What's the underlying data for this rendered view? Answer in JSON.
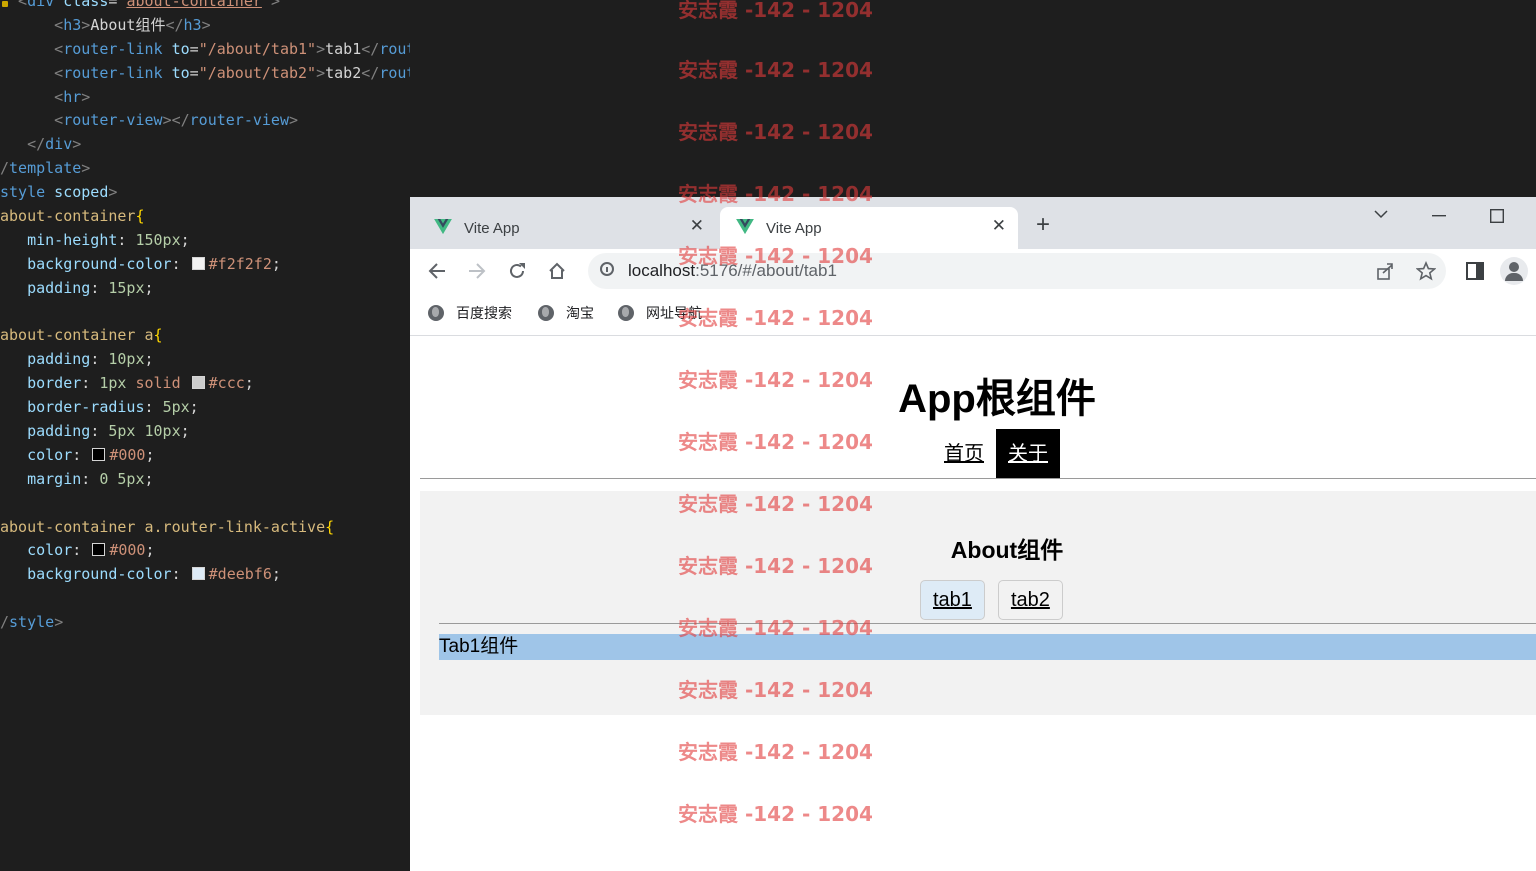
{
  "editor": {
    "lines": [
      {
        "parts": [
          {
            "c": "t-ang",
            "t": "  <"
          },
          {
            "c": "t-tag",
            "t": "div"
          },
          {
            "c": "t-attr",
            "t": " class"
          },
          {
            "c": "t-punc",
            "t": "="
          },
          {
            "c": "t-str",
            "t": "\""
          },
          {
            "c": "t-str t-ul",
            "t": "about-container"
          },
          {
            "c": "t-str",
            "t": "\""
          },
          {
            "c": "t-ang",
            "t": ">"
          }
        ]
      },
      {
        "parts": [
          {
            "c": "t-ang",
            "t": "      <"
          },
          {
            "c": "t-tag",
            "t": "h3"
          },
          {
            "c": "t-ang",
            "t": ">"
          },
          {
            "c": "t-txt",
            "t": "About组件"
          },
          {
            "c": "t-ang",
            "t": "</"
          },
          {
            "c": "t-tag",
            "t": "h3"
          },
          {
            "c": "t-ang",
            "t": ">"
          }
        ]
      },
      {
        "parts": [
          {
            "c": "t-ang",
            "t": "      <"
          },
          {
            "c": "t-tag",
            "t": "router-link"
          },
          {
            "c": "t-attr",
            "t": " to"
          },
          {
            "c": "t-punc",
            "t": "="
          },
          {
            "c": "t-str",
            "t": "\"/about/tab1\""
          },
          {
            "c": "t-ang",
            "t": ">"
          },
          {
            "c": "t-txt",
            "t": "tab1"
          },
          {
            "c": "t-ang",
            "t": "</"
          },
          {
            "c": "t-tag",
            "t": "router-link"
          },
          {
            "c": "t-ang",
            "t": ">"
          }
        ]
      },
      {
        "parts": [
          {
            "c": "t-ang",
            "t": "      <"
          },
          {
            "c": "t-tag",
            "t": "router-link"
          },
          {
            "c": "t-attr",
            "t": " to"
          },
          {
            "c": "t-punc",
            "t": "="
          },
          {
            "c": "t-str",
            "t": "\"/about/tab2\""
          },
          {
            "c": "t-ang",
            "t": ">"
          },
          {
            "c": "t-txt",
            "t": "tab2"
          },
          {
            "c": "t-ang",
            "t": "</"
          },
          {
            "c": "t-tag",
            "t": "router-link"
          },
          {
            "c": "t-ang",
            "t": ">"
          }
        ]
      },
      {
        "parts": [
          {
            "c": "t-ang",
            "t": "      <"
          },
          {
            "c": "t-tag",
            "t": "hr"
          },
          {
            "c": "t-ang",
            "t": ">"
          }
        ]
      },
      {
        "parts": [
          {
            "c": "t-ang",
            "t": "      <"
          },
          {
            "c": "t-tag",
            "t": "router-view"
          },
          {
            "c": "t-ang",
            "t": "></"
          },
          {
            "c": "t-tag",
            "t": "router-view"
          },
          {
            "c": "t-ang",
            "t": ">"
          }
        ]
      },
      {
        "parts": [
          {
            "c": "t-ang",
            "t": "   </"
          },
          {
            "c": "t-tag",
            "t": "div"
          },
          {
            "c": "t-ang",
            "t": ">"
          }
        ]
      },
      {
        "parts": [
          {
            "c": "t-ang",
            "t": "/"
          },
          {
            "c": "t-tag",
            "t": "template"
          },
          {
            "c": "t-ang",
            "t": ">"
          }
        ]
      },
      {
        "parts": [
          {
            "c": "t-tag",
            "t": "style"
          },
          {
            "c": "t-attr",
            "t": " scoped"
          },
          {
            "c": "t-ang",
            "t": ">"
          }
        ]
      },
      {
        "parts": [
          {
            "c": "t-sel",
            "t": "about-container"
          },
          {
            "c": "t-brace",
            "t": "{"
          }
        ]
      },
      {
        "parts": [
          {
            "c": "t-prop",
            "t": "   min-height"
          },
          {
            "c": "t-punc",
            "t": ": "
          },
          {
            "c": "t-num",
            "t": "150px"
          },
          {
            "c": "t-punc",
            "t": ";"
          }
        ]
      },
      {
        "parts": [
          {
            "c": "t-prop",
            "t": "   background-color"
          },
          {
            "c": "t-punc",
            "t": ": "
          },
          {
            "sw": "#f2f2f2"
          },
          {
            "c": "t-val",
            "t": "#f2f2f2"
          },
          {
            "c": "t-punc",
            "t": ";"
          }
        ]
      },
      {
        "parts": [
          {
            "c": "t-prop",
            "t": "   padding"
          },
          {
            "c": "t-punc",
            "t": ": "
          },
          {
            "c": "t-num",
            "t": "15px"
          },
          {
            "c": "t-punc",
            "t": ";"
          }
        ]
      },
      {
        "parts": []
      },
      {
        "parts": [
          {
            "c": "t-sel",
            "t": "about-container a"
          },
          {
            "c": "t-brace",
            "t": "{"
          }
        ]
      },
      {
        "parts": [
          {
            "c": "t-prop",
            "t": "   padding"
          },
          {
            "c": "t-punc",
            "t": ": "
          },
          {
            "c": "t-num",
            "t": "10px"
          },
          {
            "c": "t-punc",
            "t": ";"
          }
        ]
      },
      {
        "parts": [
          {
            "c": "t-prop",
            "t": "   border"
          },
          {
            "c": "t-punc",
            "t": ": "
          },
          {
            "c": "t-num",
            "t": "1px"
          },
          {
            "c": "t-val",
            "t": " solid "
          },
          {
            "sw": "#cccccc"
          },
          {
            "c": "t-val",
            "t": "#ccc"
          },
          {
            "c": "t-punc",
            "t": ";"
          }
        ]
      },
      {
        "parts": [
          {
            "c": "t-prop",
            "t": "   border-radius"
          },
          {
            "c": "t-punc",
            "t": ": "
          },
          {
            "c": "t-num",
            "t": "5px"
          },
          {
            "c": "t-punc",
            "t": ";"
          }
        ]
      },
      {
        "parts": [
          {
            "c": "t-prop",
            "t": "   padding"
          },
          {
            "c": "t-punc",
            "t": ": "
          },
          {
            "c": "t-num",
            "t": "5px 10px"
          },
          {
            "c": "t-punc",
            "t": ";"
          }
        ]
      },
      {
        "parts": [
          {
            "c": "t-prop",
            "t": "   color"
          },
          {
            "c": "t-punc",
            "t": ": "
          },
          {
            "sw": "#000000"
          },
          {
            "c": "t-val",
            "t": "#000"
          },
          {
            "c": "t-punc",
            "t": ";"
          }
        ]
      },
      {
        "parts": [
          {
            "c": "t-prop",
            "t": "   margin"
          },
          {
            "c": "t-punc",
            "t": ": "
          },
          {
            "c": "t-num",
            "t": "0 5px"
          },
          {
            "c": "t-punc",
            "t": ";"
          }
        ]
      },
      {
        "parts": []
      },
      {
        "parts": [
          {
            "c": "t-sel",
            "t": "about-container a.router-link-active"
          },
          {
            "c": "t-brace",
            "t": "{"
          }
        ]
      },
      {
        "parts": [
          {
            "c": "t-prop",
            "t": "   color"
          },
          {
            "c": "t-punc",
            "t": ": "
          },
          {
            "sw": "#000000"
          },
          {
            "c": "t-val",
            "t": "#000"
          },
          {
            "c": "t-punc",
            "t": ";"
          }
        ]
      },
      {
        "parts": [
          {
            "c": "t-prop",
            "t": "   background-color"
          },
          {
            "c": "t-punc",
            "t": ": "
          },
          {
            "sw": "#deebf6"
          },
          {
            "c": "t-val",
            "t": "#deebf6"
          },
          {
            "c": "t-punc",
            "t": ";"
          }
        ]
      },
      {
        "parts": []
      },
      {
        "parts": [
          {
            "c": "t-ang",
            "t": "/"
          },
          {
            "c": "t-tag",
            "t": "style"
          },
          {
            "c": "t-ang",
            "t": ">"
          }
        ]
      }
    ]
  },
  "browser": {
    "tabs": [
      {
        "title": "Vite App",
        "icon": "vite-vue-logo-icon"
      },
      {
        "title": "Vite App",
        "icon": "vite-vue-logo-icon"
      }
    ],
    "new_tab_symbol": "+",
    "close_symbol": "✕",
    "url_host": "localhost",
    "url_rest": ":5176/#/about/tab1",
    "bookmarks": [
      "百度搜索",
      "淘宝",
      "网址导航"
    ]
  },
  "page": {
    "app_title": "App根组件",
    "nav": [
      "首页",
      "关于"
    ],
    "about_title": "About组件",
    "tabs": [
      "tab1",
      "tab2"
    ],
    "router_view_text": "Tab1组件"
  },
  "watermark": "安志霞 -142 - 1204",
  "colors": {
    "about_bg": "#f2f2f2",
    "active_link_bg": "#deebf6",
    "router_view_bg": "#9fc5e8",
    "watermark": "#e23b3b"
  }
}
